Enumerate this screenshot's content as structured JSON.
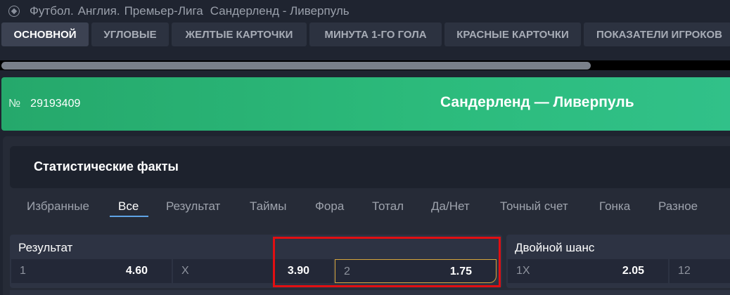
{
  "breadcrumb": {
    "sport": "Футбол.",
    "country": "Англия.",
    "league": "Премьер-Лига",
    "match": "Сандерленд - Ливерпуль"
  },
  "tabs": [
    {
      "label": "ОСНОВНОЙ",
      "active": true
    },
    {
      "label": "УГЛОВЫЕ"
    },
    {
      "label": "ЖЕЛТЫЕ КАРТОЧКИ"
    },
    {
      "label": "МИНУТА 1-ГО ГОЛА"
    },
    {
      "label": "КРАСНЫЕ КАРТОЧКИ"
    },
    {
      "label": "ПОКАЗАТЕЛИ ИГРОКОВ"
    }
  ],
  "scroll_fraction": 0.81,
  "event": {
    "number_sign": "№",
    "number": "29193409",
    "title": "Сандерленд — Ливерпуль"
  },
  "facts_title": "Статистические факты",
  "filters": [
    "Избранные",
    "Все",
    "Результат",
    "Таймы",
    "Фора",
    "Тотал",
    "Да/Нет",
    "Точный счет",
    "Гонка",
    "Разное"
  ],
  "active_filter": "Все",
  "markets": {
    "result": {
      "title": "Результат",
      "outcomes": [
        {
          "label": "1",
          "odd": "4.60"
        },
        {
          "label": "X",
          "odd": "3.90"
        },
        {
          "label": "2",
          "odd": "1.75",
          "selected": true
        }
      ]
    },
    "double_chance": {
      "title": "Двойной шанс",
      "outcomes": [
        {
          "label": "1X",
          "odd": "2.05"
        },
        {
          "label": "12",
          "odd": ""
        }
      ]
    }
  },
  "colors": {
    "banner_green": "#2cbb7c",
    "highlight_red": "#e10f12",
    "selected_border": "#d7a63d",
    "active_underline": "#5fa4e6"
  }
}
